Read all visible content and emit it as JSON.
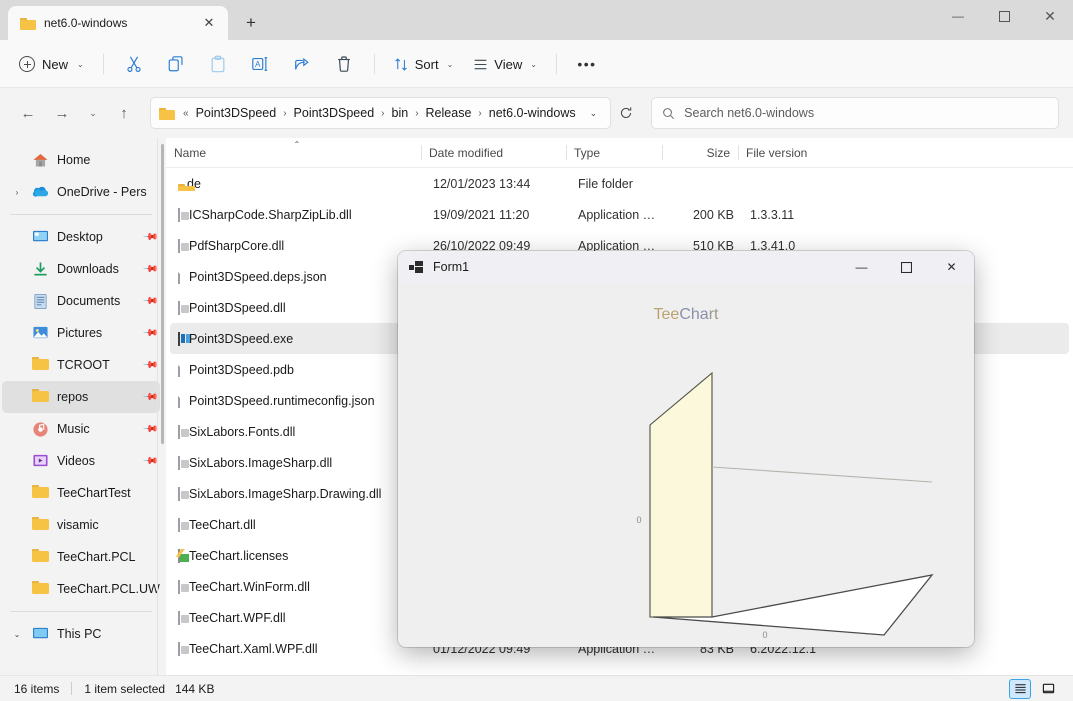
{
  "window": {
    "tab_title": "net6.0-windows",
    "tab_close": "✕",
    "new_tab": "+",
    "minimize": "—",
    "maximize": "▢",
    "close": "✕"
  },
  "toolbar": {
    "new_label": "New",
    "new_chevron": "⌄",
    "cut": "cut",
    "copy": "copy",
    "paste": "paste",
    "rename": "rename",
    "share": "share",
    "delete": "delete",
    "sort_label": "Sort",
    "sort_chevron": "⌄",
    "view_label": "View",
    "view_chevron": "⌄",
    "more_label": "•••"
  },
  "nav": {
    "back": "←",
    "forward": "→",
    "recent_chevron": "⌄",
    "up": "↑",
    "overflow": "«",
    "breadcrumbs": [
      "Point3DSpeed",
      "Point3DSpeed",
      "bin",
      "Release",
      "net6.0-windows"
    ],
    "separator": "›",
    "dropdown_chevron": "⌄",
    "refresh": "⟳",
    "search_placeholder": "Search net6.0-windows"
  },
  "sidebar": {
    "items": [
      {
        "label": "Home",
        "icon": "home-icon",
        "expand": "",
        "pin": false,
        "selected": false
      },
      {
        "label": "OneDrive - Pers",
        "icon": "onedrive-icon",
        "expand": "›",
        "pin": false,
        "selected": false
      },
      {
        "sep": true
      },
      {
        "label": "Desktop",
        "icon": "desktop-icon",
        "expand": "",
        "pin": true,
        "selected": false
      },
      {
        "label": "Downloads",
        "icon": "downloads-icon",
        "expand": "",
        "pin": true,
        "selected": false
      },
      {
        "label": "Documents",
        "icon": "documents-icon",
        "expand": "",
        "pin": true,
        "selected": false
      },
      {
        "label": "Pictures",
        "icon": "pictures-icon",
        "expand": "",
        "pin": true,
        "selected": false
      },
      {
        "label": "TCROOT",
        "icon": "folder-icon",
        "expand": "",
        "pin": true,
        "selected": false
      },
      {
        "label": "repos",
        "icon": "folder-icon",
        "expand": "",
        "pin": true,
        "selected": true
      },
      {
        "label": "Music",
        "icon": "music-icon",
        "expand": "",
        "pin": true,
        "selected": false
      },
      {
        "label": "Videos",
        "icon": "videos-icon",
        "expand": "",
        "pin": true,
        "selected": false
      },
      {
        "label": "TeeChartTest",
        "icon": "folder-icon",
        "expand": "",
        "pin": false,
        "selected": false
      },
      {
        "label": "visamic",
        "icon": "folder-icon",
        "expand": "",
        "pin": false,
        "selected": false
      },
      {
        "label": "TeeChart.PCL",
        "icon": "folder-icon",
        "expand": "",
        "pin": false,
        "selected": false
      },
      {
        "label": "TeeChart.PCL.UW",
        "icon": "folder-icon",
        "expand": "",
        "pin": false,
        "selected": false
      },
      {
        "sep": true
      },
      {
        "label": "This PC",
        "icon": "thispc-icon",
        "expand": "⌄",
        "pin": false,
        "selected": false
      }
    ]
  },
  "filelist": {
    "columns": [
      "Name",
      "Date modified",
      "Type",
      "Size",
      "File version"
    ],
    "sort_indicator": "⌃",
    "rows": [
      {
        "name": "de",
        "icon": "folder-icon",
        "date": "12/01/2023 13:44",
        "type": "File folder",
        "size": "",
        "version": "",
        "selected": false
      },
      {
        "name": "ICSharpCode.SharpZipLib.dll",
        "icon": "dll-icon",
        "date": "19/09/2021 11:20",
        "type": "Application exten...",
        "size": "200 KB",
        "version": "1.3.3.11",
        "selected": false
      },
      {
        "name": "PdfSharpCore.dll",
        "icon": "dll-icon",
        "date": "26/10/2022 09:49",
        "type": "Application exten...",
        "size": "510 KB",
        "version": "1.3.41.0",
        "selected": false
      },
      {
        "name": "Point3DSpeed.deps.json",
        "icon": "doc-icon",
        "date": "",
        "type": "",
        "size": "",
        "version": "",
        "selected": false
      },
      {
        "name": "Point3DSpeed.dll",
        "icon": "dll-icon",
        "date": "",
        "type": "",
        "size": "",
        "version": "",
        "selected": false
      },
      {
        "name": "Point3DSpeed.exe",
        "icon": "exe-icon",
        "date": "",
        "type": "",
        "size": "",
        "version": "",
        "selected": true
      },
      {
        "name": "Point3DSpeed.pdb",
        "icon": "doc-icon",
        "date": "",
        "type": "",
        "size": "",
        "version": "",
        "selected": false
      },
      {
        "name": "Point3DSpeed.runtimeconfig.json",
        "icon": "doc-icon",
        "date": "",
        "type": "",
        "size": "",
        "version": "",
        "selected": false
      },
      {
        "name": "SixLabors.Fonts.dll",
        "icon": "dll-icon",
        "date": "",
        "type": "",
        "size": "",
        "version": "",
        "selected": false
      },
      {
        "name": "SixLabors.ImageSharp.dll",
        "icon": "dll-icon",
        "date": "",
        "type": "",
        "size": "",
        "version": "",
        "selected": false
      },
      {
        "name": "SixLabors.ImageSharp.Drawing.dll",
        "icon": "dll-icon",
        "date": "",
        "type": "",
        "size": "",
        "version": "",
        "selected": false
      },
      {
        "name": "TeeChart.dll",
        "icon": "dll-icon",
        "date": "",
        "type": "",
        "size": "",
        "version": "",
        "selected": false
      },
      {
        "name": "TeeChart.licenses",
        "icon": "license-icon",
        "date": "",
        "type": "",
        "size": "",
        "version": "",
        "selected": false
      },
      {
        "name": "TeeChart.WinForm.dll",
        "icon": "dll-icon",
        "date": "",
        "type": "",
        "size": "",
        "version": "",
        "selected": false
      },
      {
        "name": "TeeChart.WPF.dll",
        "icon": "dll-icon",
        "date": "",
        "type": "",
        "size": "",
        "version": "",
        "selected": false
      },
      {
        "name": "TeeChart.Xaml.WPF.dll",
        "icon": "dll-icon",
        "date": "01/12/2022 09:49",
        "type": "Application exten...",
        "size": "83 KB",
        "version": "6.2022.12.1",
        "selected": false
      }
    ]
  },
  "statusbar": {
    "item_count": "16 items",
    "selection": "1 item selected",
    "selection_size": "144 KB",
    "details_view": "details-view",
    "large_view": "large-icons-view"
  },
  "form1": {
    "title": "Form1",
    "minimize": "—",
    "maximize": "▢",
    "close": "✕",
    "chart_title_part1": "Tee",
    "chart_title_part2": "Cha",
    "chart_title_part3": "rt",
    "y_axis_label": "0",
    "x_axis_label": "0",
    "wall_color": "#fbf8dc",
    "floor_color": "#ffffff",
    "background_color": "#efefef"
  }
}
